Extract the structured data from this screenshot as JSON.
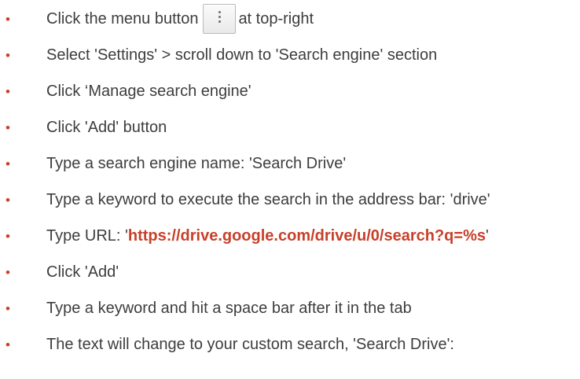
{
  "steps": [
    {
      "before": "Click the menu button",
      "icon": "menu-kebab-icon",
      "after": "at top-right"
    },
    {
      "text": "Select 'Settings' > scroll down to 'Search engine' section"
    },
    {
      "text": "Click ‘Manage search engine'"
    },
    {
      "text": "Click 'Add' button"
    },
    {
      "text": "Type a search engine name: 'Search Drive'"
    },
    {
      "text": "Type a keyword to execute the search in the address bar: 'drive'"
    },
    {
      "before": "Type URL: '",
      "url": "https://drive.google.com/drive/u/0/search?q=%s",
      "after": "'"
    },
    {
      "text": "Click 'Add'"
    },
    {
      "text": "Type a keyword and hit a space bar after it in the tab"
    },
    {
      "text": "The text will change to your custom search, 'Search Drive':"
    }
  ],
  "bullet": "•",
  "colors": {
    "bullet": "#c8402a",
    "url": "#c8402a",
    "text": "#3d3d3d"
  }
}
